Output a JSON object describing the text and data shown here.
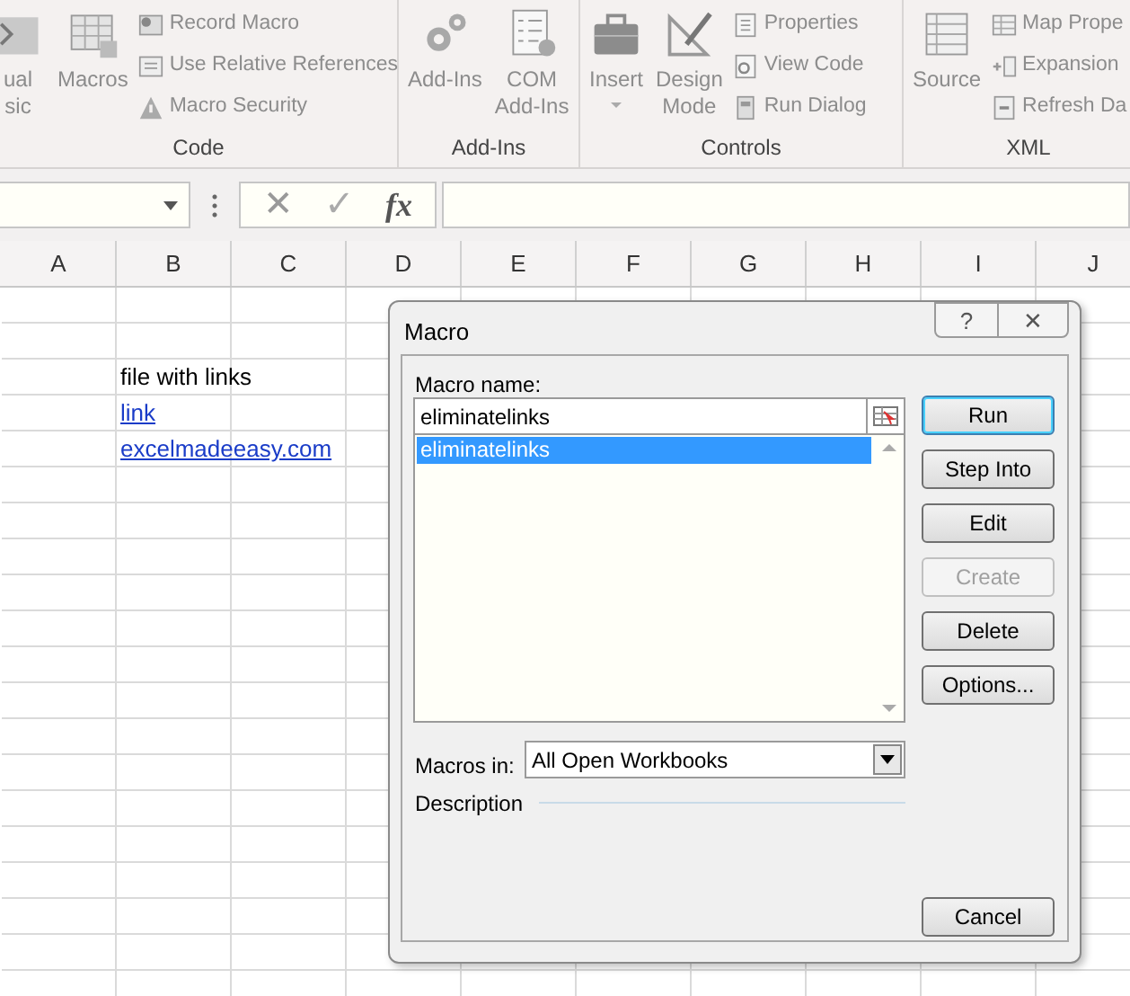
{
  "ribbon": {
    "groups": [
      {
        "label": "Code",
        "large": [
          {
            "lines": [
              "ual",
              "sic"
            ]
          },
          {
            "lines": [
              "Macros"
            ]
          }
        ],
        "small": [
          {
            "label": "Record Macro"
          },
          {
            "label": "Use Relative References"
          },
          {
            "label": "Macro Security"
          }
        ]
      },
      {
        "label": "Add-Ins",
        "large": [
          {
            "lines": [
              "Add-Ins"
            ]
          },
          {
            "lines": [
              "COM",
              "Add-Ins"
            ]
          }
        ]
      },
      {
        "label": "Controls",
        "large": [
          {
            "lines": [
              "Insert"
            ],
            "caret": true
          },
          {
            "lines": [
              "Design",
              "Mode"
            ]
          }
        ],
        "small": [
          {
            "label": "Properties"
          },
          {
            "label": "View Code"
          },
          {
            "label": "Run Dialog"
          }
        ]
      },
      {
        "label": "XML",
        "large": [
          {
            "lines": [
              "Source"
            ]
          }
        ],
        "small": [
          {
            "label": "Map Prope"
          },
          {
            "label": "Expansion"
          },
          {
            "label": "Refresh Da"
          }
        ]
      }
    ]
  },
  "formula_bar": {
    "cancel": "✕",
    "enter": "✓",
    "function": "fx"
  },
  "sheet": {
    "columns": [
      "A",
      "B",
      "C",
      "D",
      "E",
      "F",
      "G",
      "H",
      "I",
      "J"
    ],
    "cells": [
      {
        "text": "file with links",
        "kind": "text"
      },
      {
        "text": "link",
        "kind": "link"
      },
      {
        "text": "excelmadeeasy.com",
        "kind": "link"
      }
    ]
  },
  "dialog": {
    "title": "Macro",
    "help": "?",
    "close": "✕",
    "name_label": "Macro name:",
    "name_value": "eliminatelinks",
    "macros": [
      {
        "label": "eliminatelinks",
        "selected": true
      }
    ],
    "buttons": [
      {
        "label": "Run",
        "default": true,
        "disabled": false
      },
      {
        "label": "Step Into",
        "default": false,
        "disabled": false
      },
      {
        "label": "Edit",
        "default": false,
        "disabled": false
      },
      {
        "label": "Create",
        "default": false,
        "disabled": true
      },
      {
        "label": "Delete",
        "default": false,
        "disabled": false
      },
      {
        "label": "Options...",
        "default": false,
        "disabled": false
      }
    ],
    "macros_in_label": "Macros in:",
    "macros_in_value": "All Open Workbooks",
    "description_label": "Description",
    "cancel": "Cancel"
  }
}
